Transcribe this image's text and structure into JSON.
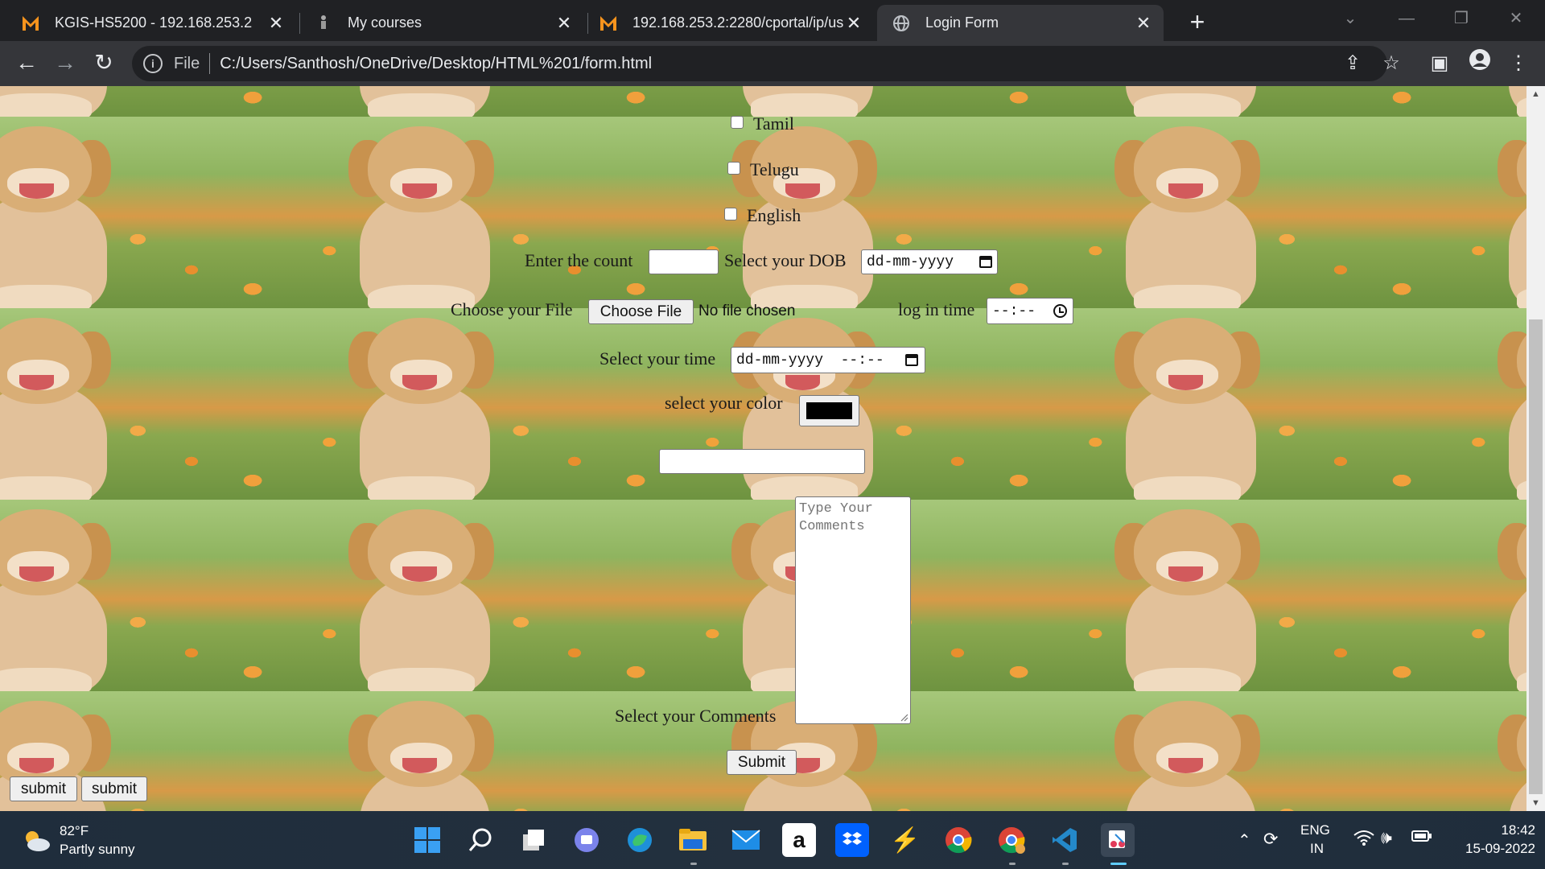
{
  "browser": {
    "tabs": [
      {
        "title": "KGIS-HS5200 - 192.168.253.2",
        "icon": "kgis-favicon-icon",
        "active": false
      },
      {
        "title": "My courses",
        "icon": "moodle-favicon-icon",
        "active": false
      },
      {
        "title": "192.168.253.2:2280/cportal/ip/us",
        "icon": "kgis-favicon-icon",
        "active": false
      },
      {
        "title": "Login Form",
        "icon": "globe-icon",
        "active": true
      }
    ],
    "address": {
      "scheme_label": "File",
      "url": "C:/Users/Santhosh/OneDrive/Desktop/HTML%201/form.html"
    }
  },
  "form": {
    "languages": [
      "Tamil",
      "Telugu",
      "English"
    ],
    "count_label": "Enter the count",
    "dob_label": "Select your DOB",
    "dob_placeholder": "dd-mm-yyyy",
    "file_label": "Choose your File",
    "file_button": "Choose File",
    "file_status": "No file chosen",
    "login_time_label": "log in time",
    "login_time_placeholder": "--:--",
    "datetime_label": "Select your time",
    "datetime_placeholder": "dd-mm-yyyy  --:--",
    "color_label": "select your color",
    "color_value": "#000000",
    "comments_placeholder": "Type Your Comments",
    "comments_label": "Select your Comments",
    "submit_center": "Submit",
    "submit_left_1": "submit",
    "submit_left_2": "submit"
  },
  "taskbar": {
    "weather_temp": "82°F",
    "weather_desc": "Partly sunny",
    "lang_top": "ENG",
    "lang_bottom": "IN",
    "time": "18:42",
    "date": "15-09-2022",
    "apps": [
      "windows-start-icon",
      "search-icon",
      "task-view-icon",
      "teams-chat-icon",
      "edge-icon",
      "file-explorer-icon",
      "mail-icon",
      "amazon-icon",
      "dropbox-icon",
      "bolt-app-icon",
      "chrome-icon",
      "chrome-profile-icon",
      "vscode-icon",
      "snipping-tool-icon"
    ]
  }
}
